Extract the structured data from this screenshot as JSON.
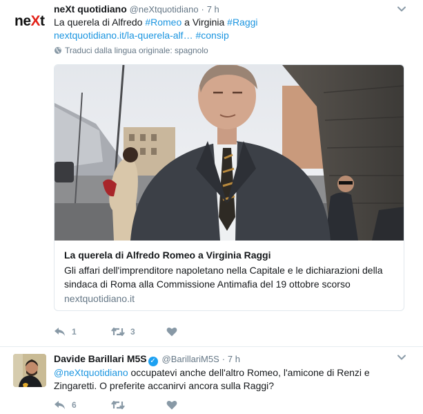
{
  "tweets": [
    {
      "name": "neXt quotidiano",
      "handle": "@neXtquotidiano",
      "separator": "·",
      "time": "7 h",
      "avatar_text": {
        "part1": "ne",
        "part2": "X",
        "part3": "t"
      },
      "text": {
        "p1": "La querela di Alfredo ",
        "hashtag1": "#Romeo",
        "p2": " a Virginia ",
        "hashtag2": "#Raggi",
        "url": "nextquotidiano.it/la-querela-alf…",
        "hashtag3": "#consip"
      },
      "translate": "Traduci dalla lingua originale: spagnolo",
      "card": {
        "title": "La querela di Alfredo Romeo a Virginia Raggi",
        "description": "Gli affari dell'imprenditore napoletano nella Capitale e le dichiarazioni della sindaca di Roma alla Commissione Antimafia del 19 ottobre scorso",
        "domain": "nextquotidiano.it"
      },
      "actions": {
        "reply_count": "1",
        "retweet_count": "3",
        "like_count": ""
      }
    },
    {
      "name": "Davide Barillari M5S",
      "handle": "@BarillariM5S",
      "separator": "·",
      "time": "7 h",
      "text": {
        "mention": "@neXtquotidiano",
        "body": " occupatevi anche dell'altro Romeo, l'amicone di Renzi e Zingaretti. O preferite accanirvi ancora sulla Raggi?"
      },
      "actions": {
        "reply_count": "6",
        "retweet_count": "",
        "like_count": ""
      }
    }
  ],
  "icons": {
    "reply": "reply-icon",
    "retweet": "retweet-icon",
    "like": "heart-icon",
    "caret": "chevron-down-icon",
    "globe": "globe-icon",
    "verified": "verified-badge-icon"
  },
  "colors": {
    "link": "#1b95e0",
    "text": "#14171a",
    "secondary": "#657786",
    "action": "#8899a6",
    "verified": "#1da1f2",
    "logo_accent": "#e2231a"
  }
}
